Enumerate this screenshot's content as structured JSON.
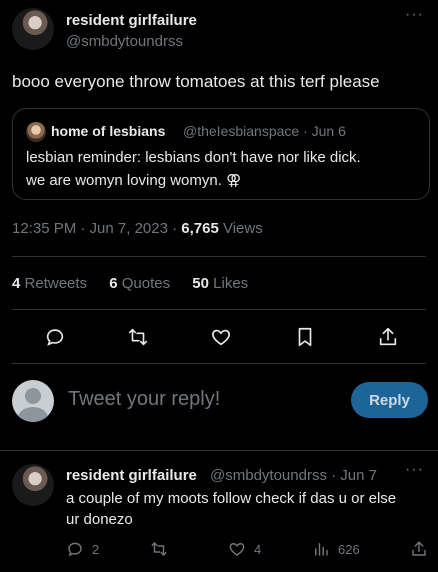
{
  "main_tweet": {
    "author_name": "resident girlfailure",
    "author_handle": "@smbdytoundrss",
    "more_label": "···",
    "text": "booo everyone throw tomatoes at this terf please",
    "quote": {
      "author_name": "home of lesbians",
      "author_handle": "@theIesbianspace · Jun 6",
      "line1": "lesbian reminder: lesbians don't have nor like dick.",
      "line2": "we are womyn loving womyn. ⚢"
    },
    "time": "12:35 PM · Jun 7, 2023 · ",
    "views_count": "6,765",
    "views_label": " Views",
    "stats": {
      "retweets_count": "4",
      "retweets_label": "Retweets",
      "quotes_count": "6",
      "quotes_label": "Quotes",
      "likes_count": "50",
      "likes_label": "Likes"
    },
    "actions": [
      "reply-icon",
      "retweet-icon",
      "like-icon",
      "bookmark-icon",
      "share-icon"
    ]
  },
  "reply_composer": {
    "placeholder": "Tweet your reply!",
    "button_label": "Reply"
  },
  "reply_tweet": {
    "author_name": "resident girlfailure",
    "author_handle": "@smbdytoundrss · Jun 7",
    "more_label": "···",
    "line1": "a couple of my moots follow check if das u or else",
    "line2": "ur donezo",
    "reply_count": "2",
    "retweet_count": "",
    "like_count": "4",
    "view_count": "626"
  },
  "colors": {
    "background": "#000000",
    "text": "#e7e9ea",
    "muted": "#71767b",
    "border": "#2f3336",
    "reply_button": "#1d6599"
  }
}
